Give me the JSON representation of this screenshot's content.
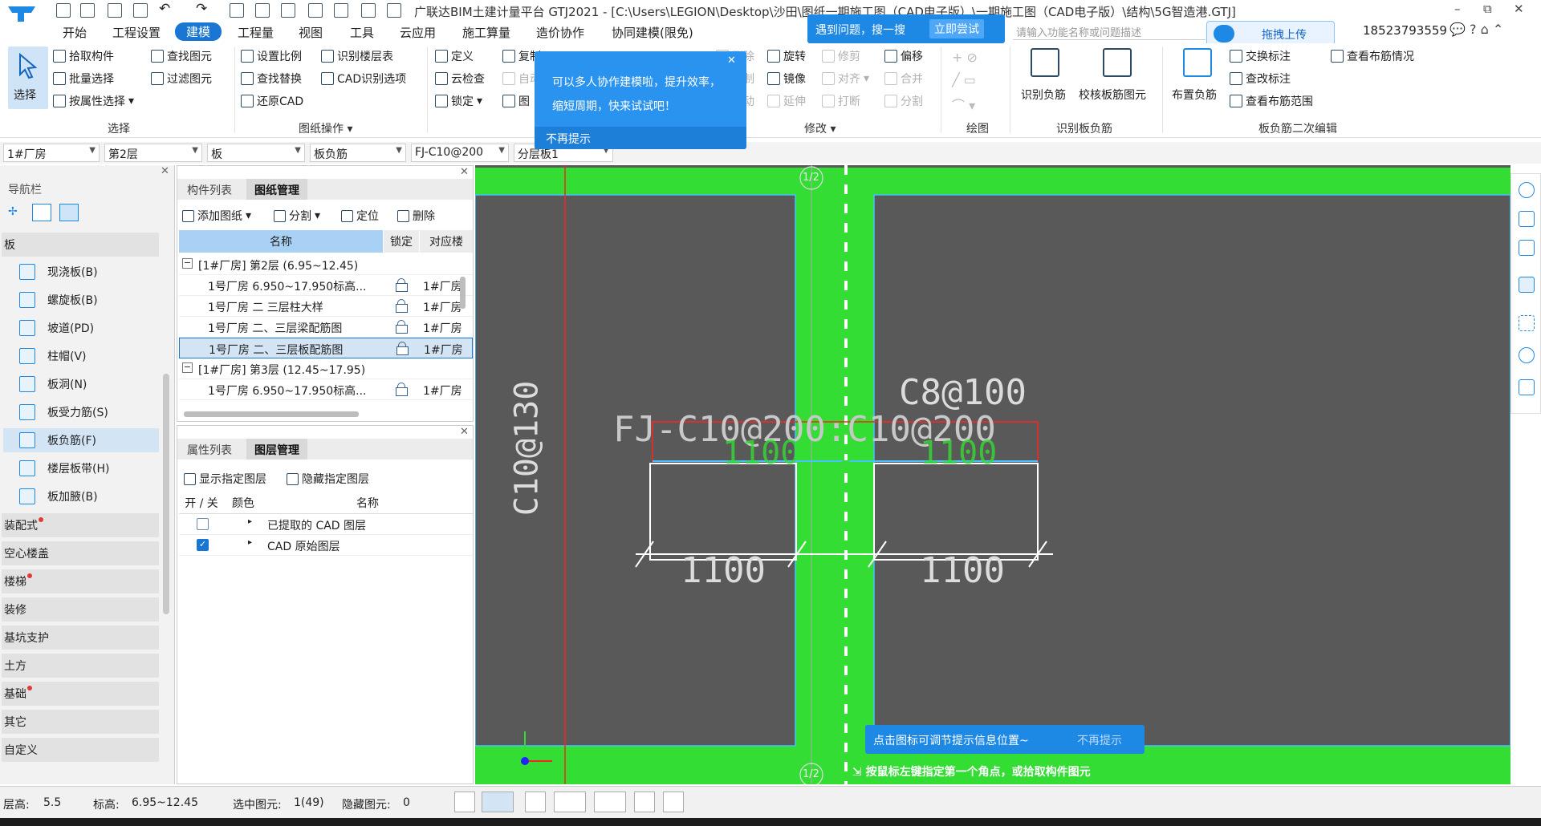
{
  "titlebar": {
    "title": "广联达BIM土建计量平台 GTJ2021 - [C:\\Users\\LEGION\\Desktop\\沙田\\图纸一期施工图（CAD电子版）\\一期施工图（CAD电子版）\\结构\\5G智造港.GTJ]",
    "minimize": "–",
    "restore": "⧉",
    "close": "✕"
  },
  "menu": {
    "items": [
      "开始",
      "工程设置",
      "建模",
      "工程量",
      "视图",
      "工具",
      "云应用",
      "施工算量",
      "造价协作",
      "协同建模(限免)"
    ],
    "active_index": 2,
    "help_placeholder": "请输入功能名称或问题描述",
    "upload_label": "拖拽上传",
    "phone": "18523793559",
    "right_icons": "💬 ? ⌂ ⌃"
  },
  "ribbon": {
    "select_group": {
      "label": "选择",
      "select_tool": "选择",
      "items": [
        "拾取构件",
        "批量选择",
        "按属性选择",
        "查找图元",
        "过滤图元"
      ]
    },
    "drawing_group": {
      "label": "图纸操作",
      "items": [
        "设置比例",
        "识别楼层表",
        "查找替换",
        "CAD识别选项",
        "还原CAD"
      ]
    },
    "general_group": {
      "items": [
        "定义",
        "复制",
        "云检查",
        "自动",
        "锁定",
        "图"
      ]
    },
    "modify_group": {
      "label": "修改",
      "items": [
        "删除",
        "旋转",
        "修剪",
        "偏移",
        "复制",
        "镜像",
        "对齐",
        "合并",
        "移动",
        "延伸",
        "打断",
        "分割"
      ]
    },
    "draw_group": {
      "label": "绘图"
    },
    "identify_group": {
      "label": "识别板负筋",
      "items": [
        "识别负筋",
        "校核板筋图元"
      ]
    },
    "edit_group": {
      "label": "板负筋二次编辑",
      "items": [
        "布置负筋",
        "交换标注",
        "查改标注",
        "查看布筋范围",
        "查看布筋情况"
      ]
    }
  },
  "dropbar": [
    "1#厂房",
    "第2层",
    "板",
    "板负筋",
    "FJ-C10@200",
    "分层板1"
  ],
  "nav": {
    "title": "导航栏",
    "section": "板",
    "items": [
      "现浇板(B)",
      "螺旋板(B)",
      "坡道(PD)",
      "柱帽(V)",
      "板洞(N)",
      "板受力筋(S)",
      "板负筋(F)",
      "楼层板带(H)",
      "板加腋(B)"
    ],
    "selected_index": 6,
    "categories": [
      {
        "label": "装配式",
        "dot": true
      },
      {
        "label": "空心楼盖",
        "dot": false
      },
      {
        "label": "楼梯",
        "dot": true
      },
      {
        "label": "装修",
        "dot": false
      },
      {
        "label": "基坑支护",
        "dot": false
      },
      {
        "label": "土方",
        "dot": false
      },
      {
        "label": "基础",
        "dot": true
      },
      {
        "label": "其它",
        "dot": false
      },
      {
        "label": "自定义",
        "dot": false
      }
    ]
  },
  "drawing_panel": {
    "tabs": [
      "构件列表",
      "图纸管理"
    ],
    "active_tab": 1,
    "toolbar": [
      "添加图纸",
      "分割",
      "定位",
      "删除"
    ],
    "columns": [
      "名称",
      "锁定",
      "对应楼"
    ],
    "rows": [
      {
        "type": "group",
        "name": "[1#厂房] 第2层 (6.95~12.45)"
      },
      {
        "type": "item",
        "name": "1号厂房 6.950~17.950标高...",
        "floor": "1#厂房"
      },
      {
        "type": "item",
        "name": "1号厂房 二 三层柱大样",
        "floor": "1#厂房"
      },
      {
        "type": "item",
        "name": "1号厂房 二、三层梁配筋图",
        "floor": "1#厂房"
      },
      {
        "type": "item",
        "name": "1号厂房 二、三层板配筋图",
        "floor": "1#厂房",
        "selected": true
      },
      {
        "type": "group",
        "name": "[1#厂房] 第3层 (12.45~17.95)"
      },
      {
        "type": "item",
        "name": "1号厂房 6.950~17.950标高...",
        "floor": "1#厂房"
      }
    ]
  },
  "layer_panel": {
    "tabs": [
      "属性列表",
      "图层管理"
    ],
    "active_tab": 1,
    "toolbar": [
      "显示指定图层",
      "隐藏指定图层"
    ],
    "columns": [
      "开 / 关",
      "颜色",
      "名称"
    ],
    "rows": [
      {
        "name": "已提取的 CAD 图层",
        "checked": false
      },
      {
        "name": "CAD 原始图层",
        "checked": true
      }
    ]
  },
  "canvas": {
    "axis_top": "1/2",
    "axis_bottom": "1/2",
    "label_vertical": "C10@130",
    "label_rebar": "C8@100",
    "label_fj": "FJ-C10@200:C10@200",
    "dim_inner_left": "1100",
    "dim_inner_right": "1100",
    "dim_left": "1100",
    "dim_right": "1100",
    "status_hint": "按鼠标左键指定第一个角点，或拾取构件图元"
  },
  "tips": {
    "search_tip": "遇到问题，搜一搜",
    "search_try": "立即尝试",
    "collab_line1": "可以多人协作建模啦，提升效率，",
    "collab_line2": "缩短周期，快来试试吧！",
    "collab_dismiss": "不再提示",
    "canvas_tip": "点击图标可调节提示信息位置~",
    "canvas_dismiss": "不再提示"
  },
  "status": {
    "floor_height_label": "层高:",
    "floor_height": "5.5",
    "elevation_label": "标高:",
    "elevation": "6.95~12.45",
    "selected_label": "选中图元:",
    "selected": "1(49)",
    "hidden_label": "隐藏图元:",
    "hidden": "0"
  },
  "colors": {
    "accent": "#1976d2",
    "canvas_bg": "#595959",
    "beam_green": "#33dd33",
    "annotation_purple": "#ff33ff",
    "dim_line": "#ffffff",
    "axis_red": "#ff2222",
    "border_cyan": "#46c3ff"
  }
}
